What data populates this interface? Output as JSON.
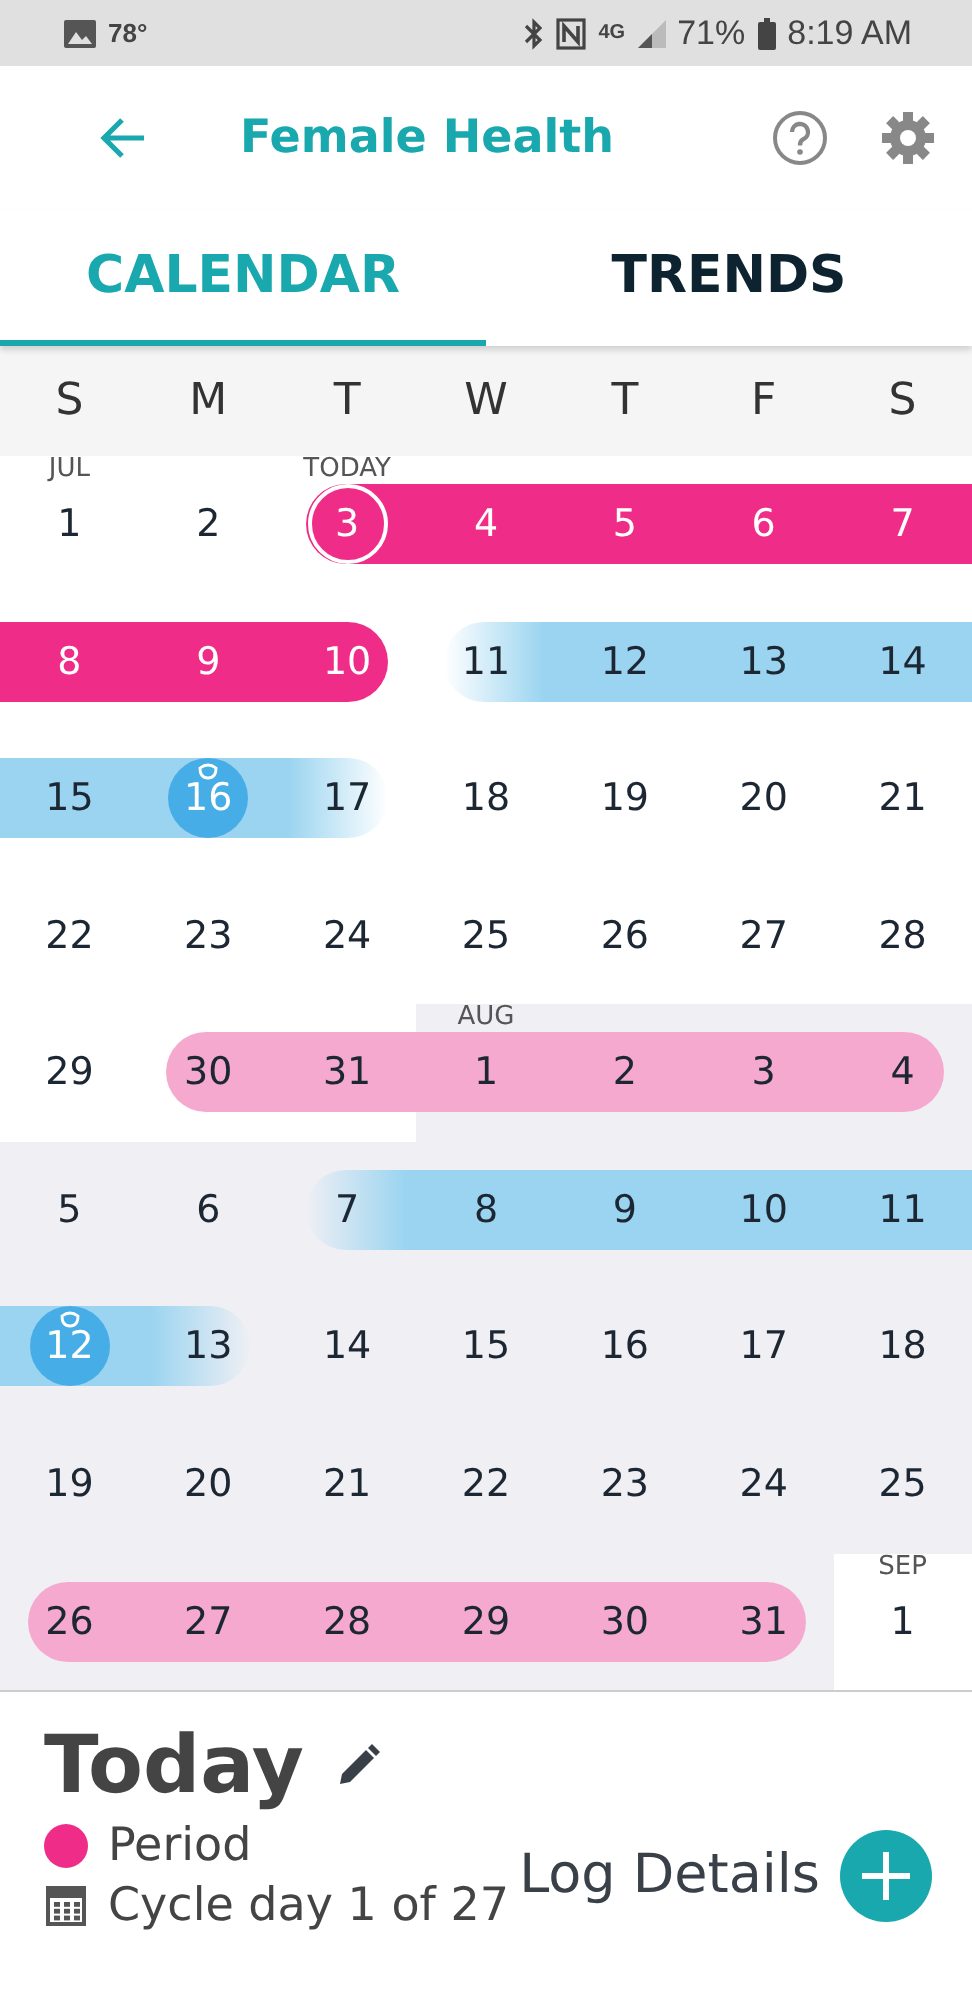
{
  "status_bar": {
    "temperature": "78°",
    "network": "4G",
    "battery": "71%",
    "time": "8:19 AM"
  },
  "app_bar": {
    "title": "Female Health"
  },
  "tabs": [
    {
      "label": "CALENDAR",
      "selected": true
    },
    {
      "label": "TRENDS",
      "selected": false
    }
  ],
  "weekdays": [
    "S",
    "M",
    "T",
    "W",
    "T",
    "F",
    "S"
  ],
  "weeks": [
    {
      "days": [
        {
          "label": "1",
          "month_label": "JUL",
          "kind": "plain",
          "shaded": false
        },
        {
          "label": "2",
          "kind": "plain",
          "shaded": false
        },
        {
          "label": "3",
          "month_label": "TODAY",
          "kind": "today",
          "shaded": false
        },
        {
          "label": "4",
          "kind": "period",
          "shaded": false
        },
        {
          "label": "5",
          "kind": "period",
          "shaded": false
        },
        {
          "label": "6",
          "kind": "period",
          "shaded": false
        },
        {
          "label": "7",
          "kind": "period",
          "shaded": false
        }
      ]
    },
    {
      "days": [
        {
          "label": "8",
          "kind": "period",
          "shaded": false
        },
        {
          "label": "9",
          "kind": "period",
          "shaded": false
        },
        {
          "label": "10",
          "kind": "period",
          "shaded": false
        },
        {
          "label": "11",
          "kind": "fertile",
          "shaded": false
        },
        {
          "label": "12",
          "kind": "fertile",
          "shaded": false
        },
        {
          "label": "13",
          "kind": "fertile",
          "shaded": false
        },
        {
          "label": "14",
          "kind": "fertile",
          "shaded": false
        }
      ]
    },
    {
      "days": [
        {
          "label": "15",
          "kind": "fertile",
          "shaded": false
        },
        {
          "label": "16",
          "kind": "ovulation",
          "shaded": false
        },
        {
          "label": "17",
          "kind": "fertile",
          "shaded": false
        },
        {
          "label": "18",
          "kind": "plain",
          "shaded": false
        },
        {
          "label": "19",
          "kind": "plain",
          "shaded": false
        },
        {
          "label": "20",
          "kind": "plain",
          "shaded": false
        },
        {
          "label": "21",
          "kind": "plain",
          "shaded": false
        }
      ]
    },
    {
      "days": [
        {
          "label": "22",
          "kind": "plain",
          "shaded": false
        },
        {
          "label": "23",
          "kind": "plain",
          "shaded": false
        },
        {
          "label": "24",
          "kind": "plain",
          "shaded": false
        },
        {
          "label": "25",
          "kind": "plain",
          "shaded": false
        },
        {
          "label": "26",
          "kind": "plain",
          "shaded": false
        },
        {
          "label": "27",
          "kind": "plain",
          "shaded": false
        },
        {
          "label": "28",
          "kind": "plain",
          "shaded": false
        }
      ]
    },
    {
      "days": [
        {
          "label": "29",
          "kind": "plain",
          "shaded": false
        },
        {
          "label": "30",
          "kind": "predicted",
          "shaded": false
        },
        {
          "label": "31",
          "kind": "predicted",
          "shaded": false
        },
        {
          "label": "1",
          "month_label": "AUG",
          "kind": "predicted",
          "shaded": true
        },
        {
          "label": "2",
          "kind": "predicted",
          "shaded": true
        },
        {
          "label": "3",
          "kind": "predicted",
          "shaded": true
        },
        {
          "label": "4",
          "kind": "predicted",
          "shaded": true
        }
      ]
    },
    {
      "days": [
        {
          "label": "5",
          "kind": "plain",
          "shaded": true
        },
        {
          "label": "6",
          "kind": "plain",
          "shaded": true
        },
        {
          "label": "7",
          "kind": "fertile",
          "shaded": true
        },
        {
          "label": "8",
          "kind": "fertile",
          "shaded": true
        },
        {
          "label": "9",
          "kind": "fertile",
          "shaded": true
        },
        {
          "label": "10",
          "kind": "fertile",
          "shaded": true
        },
        {
          "label": "11",
          "kind": "fertile",
          "shaded": true
        }
      ]
    },
    {
      "days": [
        {
          "label": "12",
          "kind": "ovulation",
          "shaded": true
        },
        {
          "label": "13",
          "kind": "fertile",
          "shaded": true
        },
        {
          "label": "14",
          "kind": "plain",
          "shaded": true
        },
        {
          "label": "15",
          "kind": "plain",
          "shaded": true
        },
        {
          "label": "16",
          "kind": "plain",
          "shaded": true
        },
        {
          "label": "17",
          "kind": "plain",
          "shaded": true
        },
        {
          "label": "18",
          "kind": "plain",
          "shaded": true
        }
      ]
    },
    {
      "days": [
        {
          "label": "19",
          "kind": "plain",
          "shaded": true
        },
        {
          "label": "20",
          "kind": "plain",
          "shaded": true
        },
        {
          "label": "21",
          "kind": "plain",
          "shaded": true
        },
        {
          "label": "22",
          "kind": "plain",
          "shaded": true
        },
        {
          "label": "23",
          "kind": "plain",
          "shaded": true
        },
        {
          "label": "24",
          "kind": "plain",
          "shaded": true
        },
        {
          "label": "25",
          "kind": "plain",
          "shaded": true
        }
      ]
    },
    {
      "days": [
        {
          "label": "26",
          "kind": "predicted",
          "shaded": true
        },
        {
          "label": "27",
          "kind": "predicted",
          "shaded": true
        },
        {
          "label": "28",
          "kind": "predicted",
          "shaded": true
        },
        {
          "label": "29",
          "kind": "predicted",
          "shaded": true
        },
        {
          "label": "30",
          "kind": "predicted",
          "shaded": true
        },
        {
          "label": "31",
          "kind": "predicted",
          "shaded": true
        },
        {
          "label": "1",
          "month_label": "SEP",
          "kind": "plain",
          "shaded": false
        }
      ]
    }
  ],
  "summary": {
    "title": "Today",
    "legend": {
      "label": "Period",
      "color": "#ef2d88"
    },
    "cycle": "Cycle day 1 of 27",
    "action": "Log Details"
  }
}
